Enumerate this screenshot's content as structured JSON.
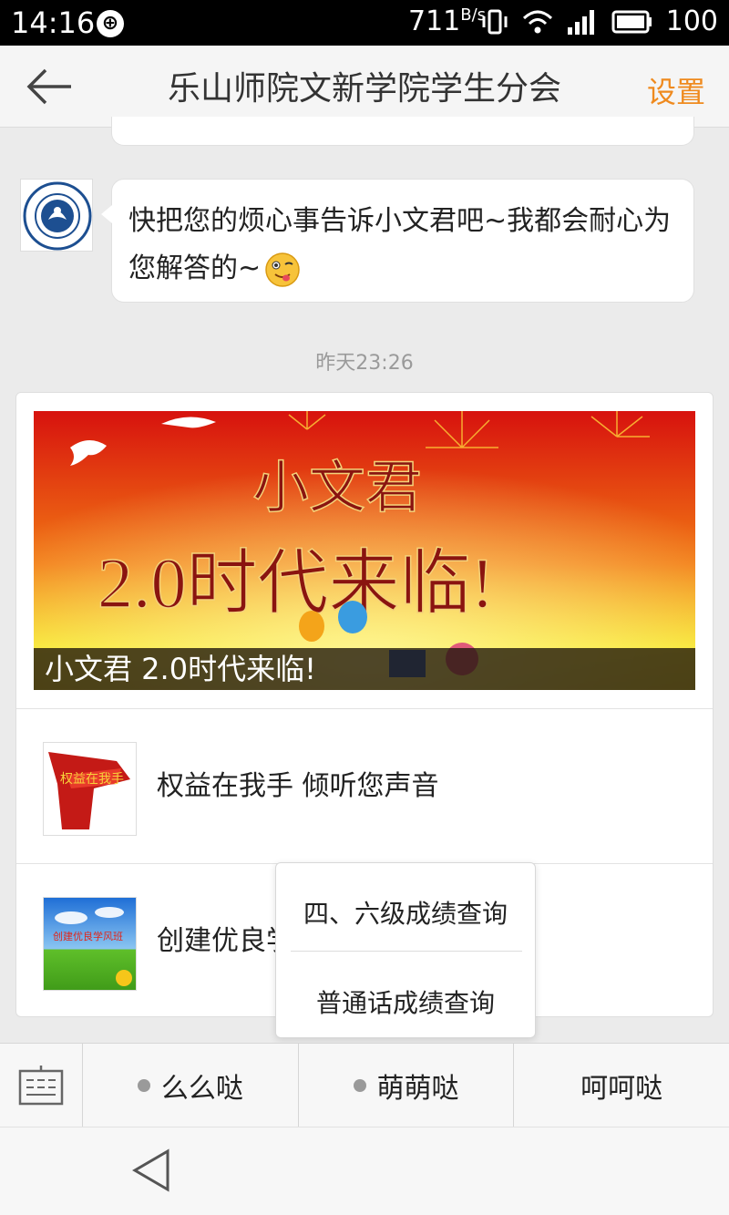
{
  "status_bar": {
    "time": "14:16",
    "speed": "711",
    "speed_unit": "B/s",
    "battery": "100",
    "icons": [
      "sync-icon",
      "vibrate-icon",
      "wifi-icon",
      "signal-icon",
      "battery-icon"
    ]
  },
  "header": {
    "title": "乐山师院文新学院学生分会",
    "settings_label": "设置",
    "back_icon": "back-arrow-icon"
  },
  "chat": {
    "message_text": "快把您的烦心事告诉小文君吧~我都会耐心为您解答的~",
    "emoji": "tongue-out-emoji",
    "timestamp": "昨天23:26",
    "avatar_text": "Leshan Normal University"
  },
  "article": {
    "banner_caption": "小文君 2.0时代来临!",
    "banner_art_text": {
      "line1": "小文君",
      "line2": "2.0时代来临!"
    },
    "items": [
      {
        "title": "权益在我手 倾听您声音",
        "thumb_text": "权益在我手"
      },
      {
        "title": "创建优良学",
        "thumb_text": "创建优良学风班"
      }
    ]
  },
  "popup_menu": {
    "items": [
      {
        "label": "四、六级成绩查询"
      },
      {
        "label": "普通话成绩查询"
      }
    ]
  },
  "menu_bar": {
    "keyboard_icon": "keyboard-icon",
    "items": [
      {
        "label": "么么哒",
        "has_submenu": true
      },
      {
        "label": "萌萌哒",
        "has_submenu": true
      },
      {
        "label": "呵呵哒",
        "has_submenu": false
      }
    ]
  },
  "colors": {
    "accent": "#ef8a1e",
    "background": "#ebebeb"
  }
}
